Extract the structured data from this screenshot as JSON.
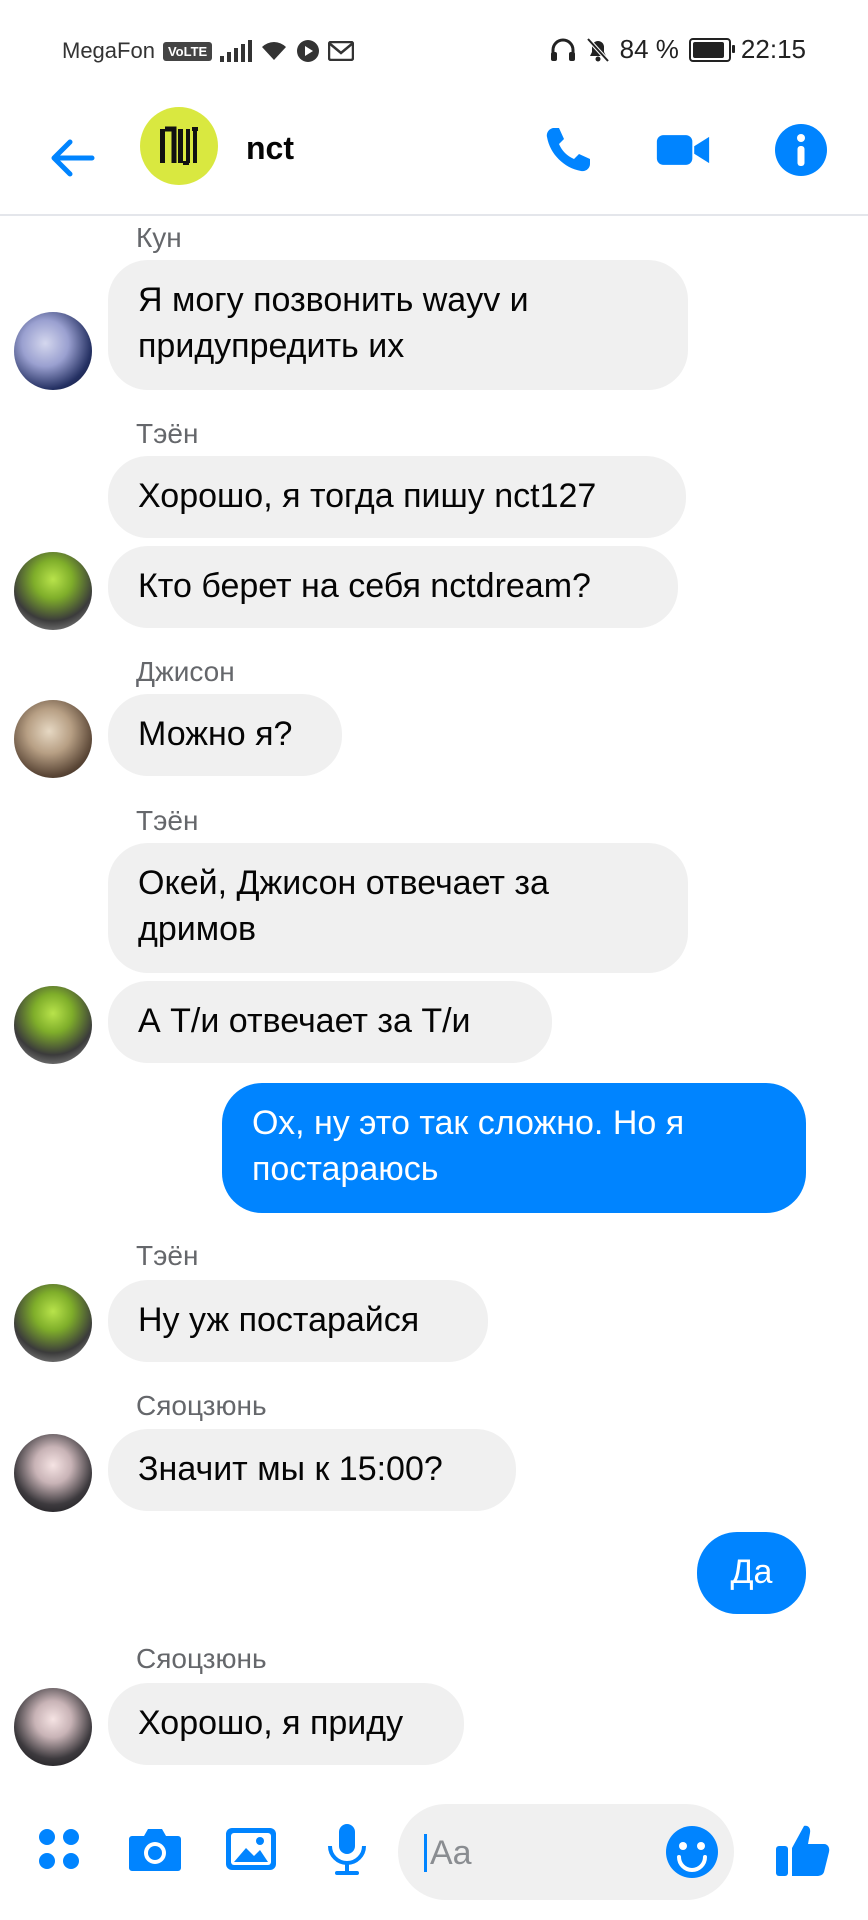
{
  "status": {
    "carrier": "MegaFon",
    "volte": "VoLTE",
    "battery": "84 %",
    "time": "22:15"
  },
  "header": {
    "title": "nct"
  },
  "messages": [
    {
      "sender": "Кун",
      "text": "Я могу позвонить wayv и\nпридупредить их"
    },
    {
      "sender": "Тэён",
      "text": "Хорошо, я тогда пишу nct127"
    },
    {
      "text": "Кто берет на себя nctdream?"
    },
    {
      "sender": "Джисон",
      "text": "Можно я?"
    },
    {
      "sender": "Тэён",
      "text": "Окей, Джисон отвечает за\nдримов"
    },
    {
      "text": "А Т/и отвечает за Т/и"
    },
    {
      "outgoing": true,
      "text": "Ох, ну это так сложно. Но я\nпостараюсь"
    },
    {
      "sender": "Тэён",
      "text": "Ну уж постарайся"
    },
    {
      "sender": "Сяоцзюнь",
      "text": "Значит мы к 15:00?"
    },
    {
      "outgoing": true,
      "text": "Да"
    },
    {
      "sender": "Сяоцзюнь",
      "text": "Хорошо, я приду"
    }
  ],
  "composer": {
    "placeholder": "Aa"
  },
  "colors": {
    "accent": "#0084ff",
    "incoming_bubble": "#f0f0f0",
    "group_avatar": "#d9e840"
  },
  "icons": [
    "back-arrow-icon",
    "phone-icon",
    "video-camera-icon",
    "info-icon",
    "apps-icon",
    "camera-icon",
    "gallery-icon",
    "microphone-icon",
    "emoji-icon",
    "like-icon"
  ]
}
